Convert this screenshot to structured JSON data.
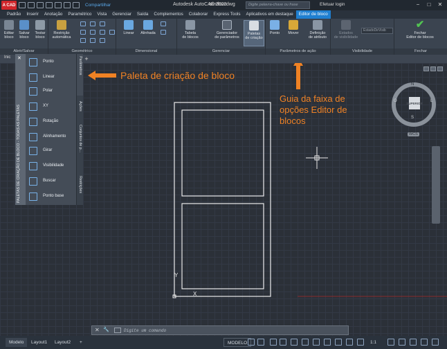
{
  "titlebar": {
    "logo": "A CAD",
    "share": "Compartilhar",
    "title": "Autodesk AutoCAD 2023",
    "file": "window.dwg",
    "search_placeholder": "Digite palavra-chave ou frase",
    "login": "Efetuar login",
    "window_controls": [
      "−",
      "□",
      "✕"
    ]
  },
  "menu_tabs": [
    "Padrão",
    "Inserir",
    "Anotação",
    "Paramétrico",
    "Vista",
    "Gerenciar",
    "Saída",
    "Complementos",
    "Colaborar",
    "Express Tools",
    "Aplicativos em destaque",
    "Editor de bloco"
  ],
  "ribbon": {
    "groups": {
      "open_save": "Abrir/Salvar",
      "geometric": "Geométrico",
      "dimensional": "Dimensional",
      "manage": "Gerenciar",
      "action_params": "Parâmetros de ação",
      "visibility": "Visibilidade",
      "close": "Fechar"
    },
    "buttons": {
      "edit_block": [
        "Editar",
        "bloco"
      ],
      "save_block": [
        "Salvar",
        "bloco"
      ],
      "test_block": [
        "Testar",
        "bloco"
      ],
      "auto_constrain": [
        "Restrição",
        "automática"
      ],
      "linear": [
        "Linear"
      ],
      "aligned": [
        "Alinhada"
      ],
      "block_table": [
        "Tabela",
        "de blocos"
      ],
      "param_manager": [
        "Gerenciador",
        "de parâmetros"
      ],
      "palettes": [
        "Paletas",
        "de criação"
      ],
      "point": [
        "Ponto"
      ],
      "move": [
        "Mover"
      ],
      "attr_def": [
        "Definição",
        "de atributo"
      ],
      "vis_states": [
        "Estados",
        "de visibilidade"
      ],
      "vis_state_value": "EstadoDeVisib",
      "close_editor": [
        "Fechar",
        "Editor de blocos"
      ]
    }
  },
  "doc_tabs": {
    "start": "Inic",
    "new_tab": "+"
  },
  "palette": {
    "title": "PALETAS DE CRIAÇÃO DE BLOCO - TODAS AS PALETAS",
    "close": "✕",
    "items": [
      "Ponto",
      "Linear",
      "Polar",
      "XY",
      "Rotação",
      "Alinhamento",
      "Girar",
      "Visibilidade",
      "Buscar",
      "Ponto base"
    ],
    "tabs": [
      "Parâmetros",
      "Ações",
      "Conjuntos de p...",
      "Restrições"
    ]
  },
  "annotations": {
    "palette": "Paleta de criação de bloco",
    "ribbon_guide": [
      "Guia da faixa de",
      "opções Editor de",
      "blocos"
    ]
  },
  "viewcube": {
    "face": "SUPERIOR",
    "north": "N",
    "south": "S",
    "east": "L",
    "west": "O",
    "wcs": "WCS"
  },
  "axes": {
    "y": "Y",
    "x": "X"
  },
  "command_line": {
    "placeholder": "Digite um comando",
    "buttons": [
      "✕",
      "🔧"
    ]
  },
  "status": {
    "tabs": [
      "Modelo",
      "Layout1",
      "Layout2",
      "+"
    ],
    "mode": "MODELO",
    "scale": "1:1"
  },
  "colors": {
    "accent": "#1f7fd0",
    "annotation": "#f08224",
    "logo": "#d0262b"
  }
}
